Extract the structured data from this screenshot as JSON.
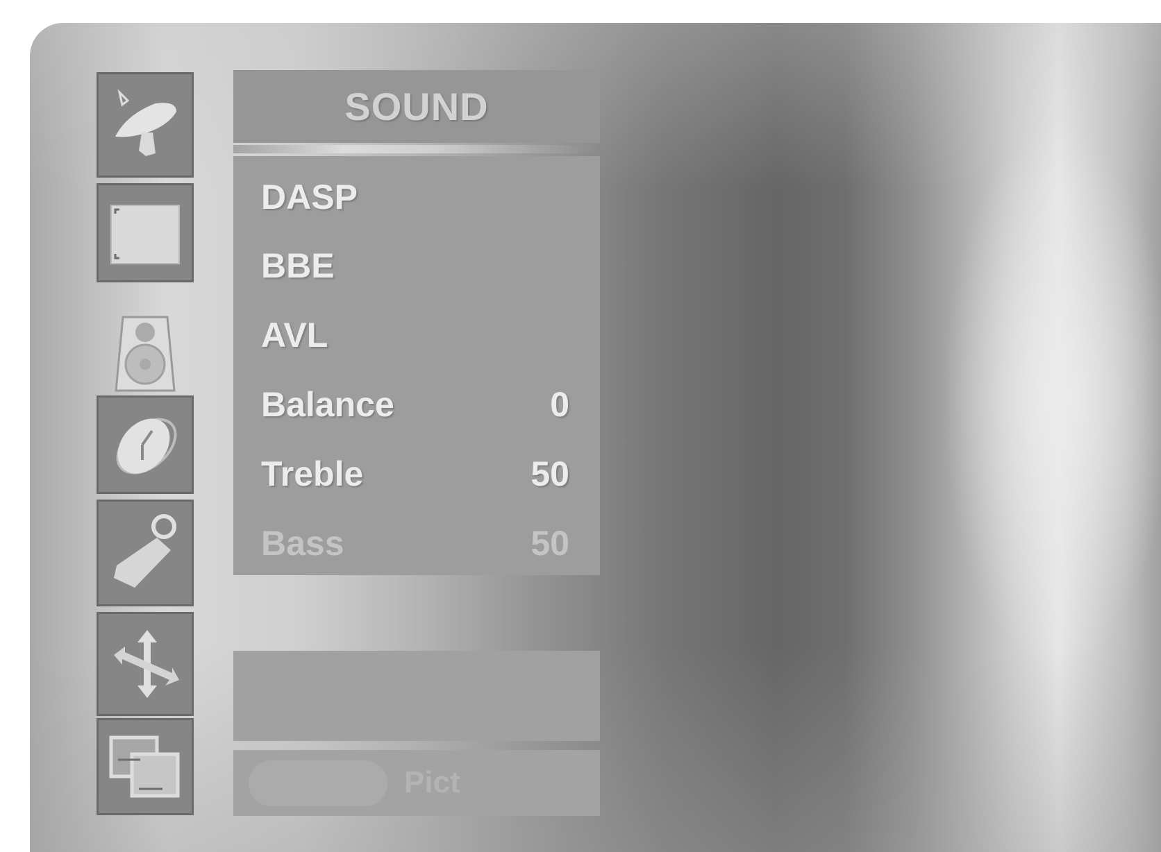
{
  "menu": {
    "title": "SOUND",
    "items": [
      {
        "label": "DASP",
        "value": ""
      },
      {
        "label": "BBE",
        "value": ""
      },
      {
        "label": "AVL",
        "value": ""
      },
      {
        "label": "Balance",
        "value": "0"
      },
      {
        "label": "Treble",
        "value": "50"
      },
      {
        "label": "Bass",
        "value": "50"
      }
    ]
  },
  "sidebar": {
    "icons": [
      {
        "name": "satellite-dish-icon"
      },
      {
        "name": "picture-screen-icon"
      },
      {
        "name": "speaker-icon",
        "active": true
      },
      {
        "name": "clock-icon"
      },
      {
        "name": "key-tag-icon"
      },
      {
        "name": "move-arrows-icon"
      },
      {
        "name": "pip-windows-icon"
      }
    ]
  },
  "footer": {
    "text": "Pict"
  },
  "colors": {
    "panel": "#9d9d9d",
    "text": "#ececec",
    "tile": "#868686"
  }
}
